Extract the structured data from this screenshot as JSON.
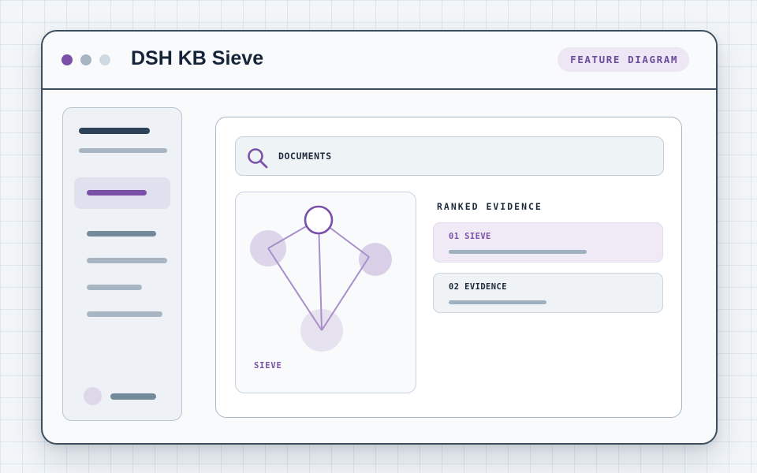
{
  "app": {
    "title": "DSH KB Sieve",
    "badge": "FEATURE DIAGRAM"
  },
  "window_controls": [
    {
      "name": "close",
      "color": "#7a4fa8"
    },
    {
      "name": "minimize",
      "color": "#a7b5c2"
    },
    {
      "name": "maximize",
      "color": "#cfd9e2"
    }
  ],
  "search": {
    "label": "DOCUMENTS",
    "icon": "search-icon"
  },
  "diagram": {
    "label": "SIEVE",
    "nodes": [
      "top-node",
      "left-node",
      "right-node",
      "bottom-node"
    ]
  },
  "ranked": {
    "title": "RANKED EVIDENCE",
    "items": [
      {
        "label": "01 SIEVE",
        "score": 0.85
      },
      {
        "label": "02 EVIDENCE",
        "score": 0.6
      }
    ]
  },
  "colors": {
    "accent": "#7a52a8",
    "border": "#3d4f5f",
    "placeholder": "#9fb0bf",
    "highlight": "#efeaf5"
  }
}
